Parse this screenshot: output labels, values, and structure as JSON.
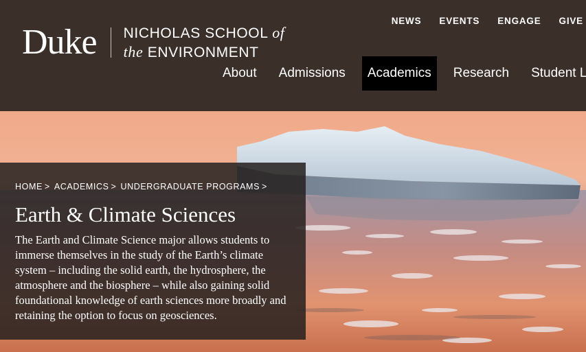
{
  "logo": {
    "duke": "Duke",
    "school_line1_a": "NICHOLAS SCHOOL",
    "school_line1_b": "of",
    "school_line2_a": "the",
    "school_line2_b": "ENVIRONMENT"
  },
  "utility_nav": [
    "NEWS",
    "EVENTS",
    "ENGAGE",
    "GIVE"
  ],
  "main_nav": {
    "items": [
      "About",
      "Admissions",
      "Academics",
      "Research",
      "Student Lif"
    ],
    "active": "Academics"
  },
  "breadcrumb": [
    "HOME",
    "ACADEMICS",
    "UNDERGRADUATE PROGRAMS"
  ],
  "breadcrumb_sep": ">",
  "page_title": "Earth & Climate Sciences",
  "description": "The Earth and Climate Science major allows students to immerse themselves in the study of the Earth’s climate system – including the solid earth, the hydrosphere, the atmosphere and the biosphere – while also gaining solid foundational knowledge of earth sciences more broadly and retaining the option to focus on geosciences.",
  "colors": {
    "header_bg": "#3b2f2a",
    "active_nav_bg": "#000000",
    "caption_bg": "#26211f"
  },
  "hero_image": "iceberg-at-sunset"
}
